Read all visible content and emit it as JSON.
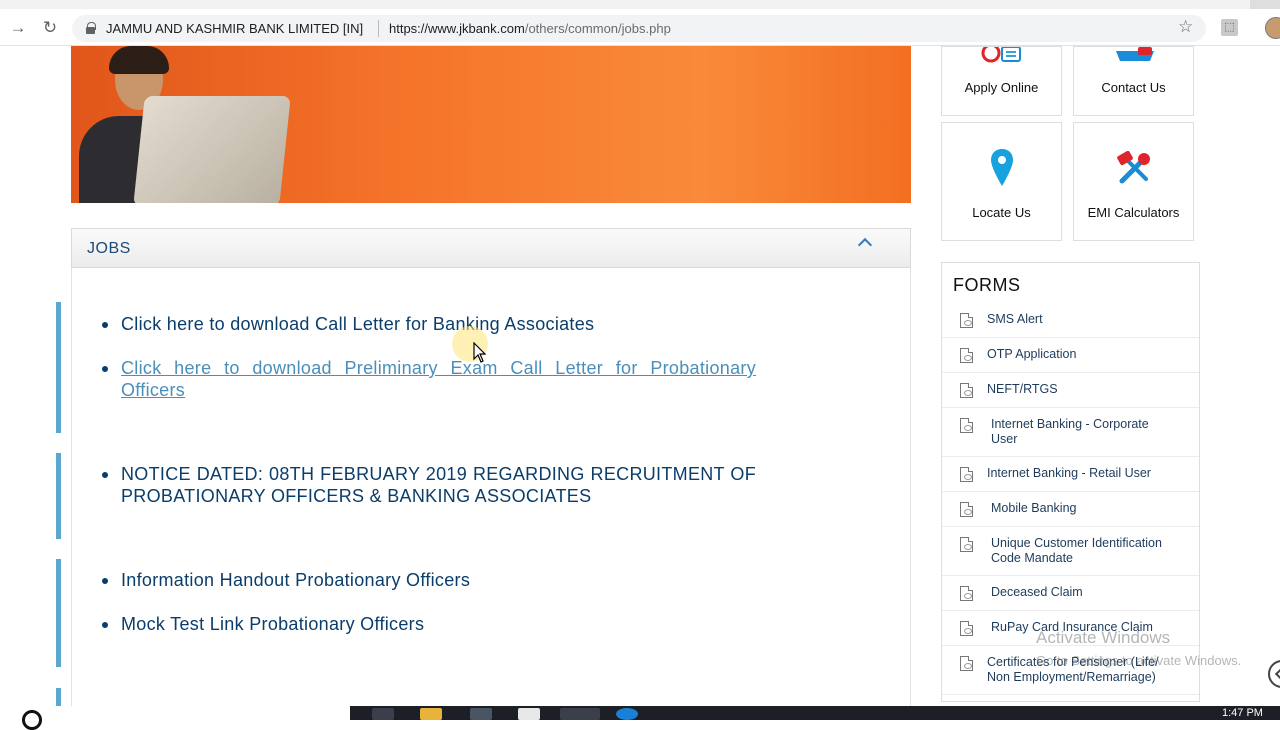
{
  "browser": {
    "site_name": "JAMMU AND KASHMIR BANK LIMITED [IN]",
    "url_host": "https://www.jkbank.com",
    "url_path": "/others/common/jobs.php"
  },
  "quick_links": [
    {
      "label": "Apply Online",
      "icon": "at-mail-icon"
    },
    {
      "label": "Contact Us",
      "icon": "contact-icon"
    },
    {
      "label": "Locate Us",
      "icon": "map-pin-icon"
    },
    {
      "label": "EMI Calculators",
      "icon": "tools-icon"
    }
  ],
  "jobs": {
    "title": "JOBS",
    "blocks": [
      {
        "items": [
          {
            "text": "Click here to download Call Letter for Banking Associates",
            "visited": false
          },
          {
            "text": "Click here to download Preliminary Exam Call Letter for Probationary Officers",
            "visited": true
          }
        ]
      },
      {
        "items": [
          {
            "text": "NOTICE DATED: 08TH FEBRUARY 2019 REGARDING RECRUITMENT OF PROBATIONARY OFFICERS & BANKING ASSOCIATES",
            "visited": false
          }
        ]
      },
      {
        "items": [
          {
            "text": "Information Handout Probationary Officers",
            "visited": false
          },
          {
            "text": "Mock Test Link Probationary Officers",
            "visited": false
          }
        ]
      }
    ]
  },
  "forms": {
    "title": "FORMS",
    "items": [
      "SMS Alert",
      "OTP Application",
      "NEFT/RTGS",
      "Internet Banking - Corporate User",
      "Internet Banking - Retail User",
      "Mobile Banking",
      "Unique Customer Identification Code Mandate",
      "Deceased Claim",
      "RuPay Card Insurance Claim",
      "Certificates for Pensioner (Life/ Non Employment/Remarriage)"
    ]
  },
  "watermark": {
    "line1": "Activate Windows",
    "line2": "Go to Settings to activate Windows."
  },
  "taskbar": {
    "clock": "1:47 PM"
  },
  "colors": {
    "link": "#0a3d6b",
    "visited_link": "#4a8fbb",
    "accent_bar": "#5aa7d0",
    "hero_orange": "#f5742a"
  }
}
